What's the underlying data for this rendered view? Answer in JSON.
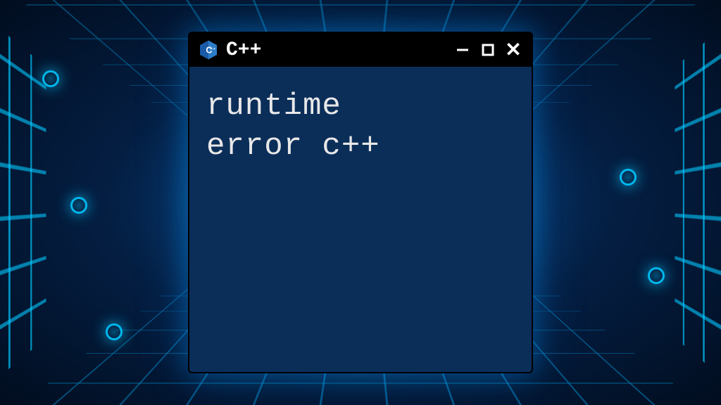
{
  "window": {
    "title": "C++",
    "icon_name": "cpp-logo"
  },
  "terminal": {
    "content": "runtime\nerror c++"
  },
  "colors": {
    "terminal_bg": "#0b2e59",
    "titlebar_bg": "#000",
    "text": "#e8e8e8",
    "glow": "#00c8ff"
  }
}
